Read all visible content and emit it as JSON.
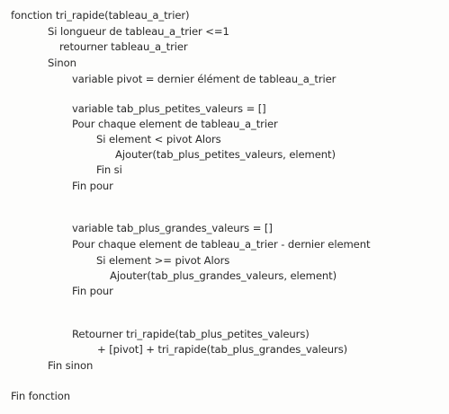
{
  "pseudocode": {
    "lines": [
      "fonction tri_rapide(tableau_a_trier)",
      "Si longueur de tableau_a_trier <=1",
      "retourner tableau_a_trier",
      "Sinon",
      "variable pivot = dernier élément de tableau_a_trier",
      "variable tab_plus_petites_valeurs = []",
      "Pour chaque element de tableau_a_trier",
      "Si element < pivot Alors",
      "Ajouter(tab_plus_petites_valeurs, element)",
      "Fin si",
      "Fin pour",
      "variable tab_plus_grandes_valeurs = []",
      "Pour chaque element de tableau_a_trier - dernier element",
      "Si element >= pivot Alors",
      "Ajouter(tab_plus_grandes_valeurs, element)",
      "Fin pour",
      "Retourner tri_rapide(tab_plus_petites_valeurs)",
      "+ [pivot] + tri_rapide(tab_plus_grandes_valeurs)",
      "Fin sinon",
      "Fin fonction"
    ]
  }
}
